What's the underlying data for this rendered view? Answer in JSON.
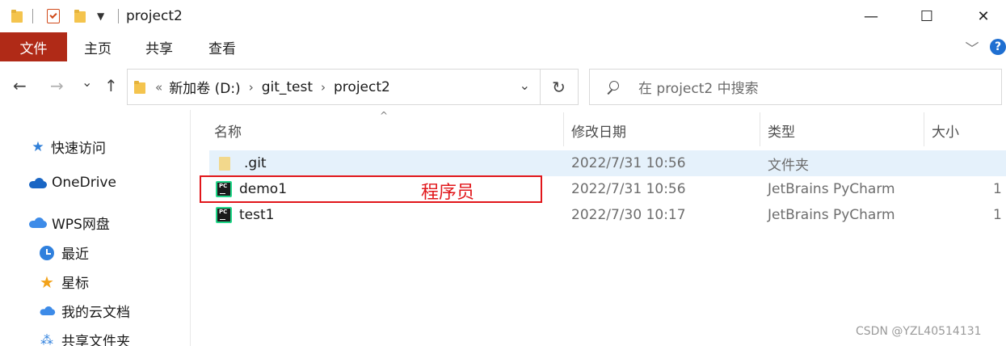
{
  "window": {
    "title": "project2",
    "minimize": "—",
    "maximize": "☐",
    "close": "✕"
  },
  "ribbon": {
    "tabs": [
      "文件",
      "主页",
      "共享",
      "查看"
    ],
    "expand": "﹀",
    "help": "?"
  },
  "nav": {
    "back": "←",
    "forward": "→",
    "recent": "⌄",
    "up": "↑",
    "overflow": "«",
    "breadcrumbs": [
      "新加卷 (D:)",
      "git_test",
      "project2"
    ],
    "separator": "›",
    "dropdown": "⌄",
    "refresh": "↻"
  },
  "search": {
    "placeholder": "在 project2 中搜索"
  },
  "sidebar": {
    "items": [
      {
        "label": "快速访问",
        "icon": "star-icon"
      },
      {
        "label": "OneDrive",
        "icon": "cloud-icon"
      },
      {
        "label": "WPS网盘",
        "icon": "wps-cloud-icon"
      },
      {
        "label": "最近",
        "icon": "clock-icon"
      },
      {
        "label": "星标",
        "icon": "star-icon"
      },
      {
        "label": "我的云文档",
        "icon": "cloud-icon"
      },
      {
        "label": "共享文件夹",
        "icon": "share-icon"
      }
    ]
  },
  "columns": {
    "name": "名称",
    "modified": "修改日期",
    "type": "类型",
    "size": "大小",
    "sort_indicator": "^"
  },
  "files": [
    {
      "name": ".git",
      "modified": "2022/7/31 10:56",
      "type": "文件夹",
      "size": "",
      "icon": "folder-icon",
      "selected": true
    },
    {
      "name": "demo1",
      "modified": "2022/7/31 10:56",
      "type": "JetBrains PyCharm",
      "size": "1",
      "icon": "pycharm-icon"
    },
    {
      "name": "test1",
      "modified": "2022/7/30 10:17",
      "type": "JetBrains PyCharm",
      "size": "1",
      "icon": "pycharm-icon"
    }
  ],
  "pycharm_badge": "PC",
  "annotation": {
    "text": "程序员",
    "color": "#e1161a"
  },
  "watermark": "CSDN @YZL40514131",
  "colors": {
    "file_tab": "#b02a17",
    "selection": "#e5f1fb",
    "help": "#1f6fd1"
  }
}
